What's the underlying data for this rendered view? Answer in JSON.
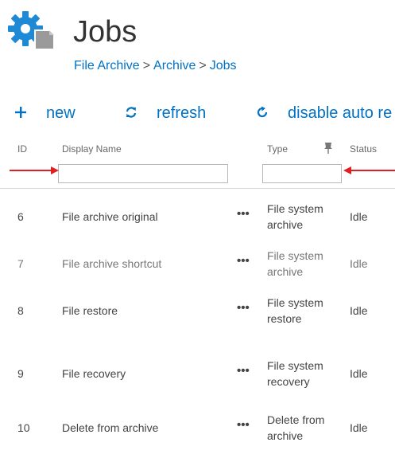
{
  "header": {
    "title": "Jobs",
    "breadcrumb": [
      "File Archive",
      "Archive",
      "Jobs"
    ],
    "breadcrumb_separator": ">"
  },
  "toolbar": {
    "new_label": "new",
    "refresh_label": "refresh",
    "disable_auto_refresh_label": "disable auto re"
  },
  "columns": {
    "id": "ID",
    "display_name": "Display Name",
    "type": "Type",
    "status": "Status"
  },
  "filters": {
    "display_name_value": "",
    "type_value": ""
  },
  "rows": [
    {
      "id": "6",
      "name": "File archive original",
      "type_line1": "File system",
      "type_line2": "archive",
      "status": "Idle"
    },
    {
      "id": "7",
      "name": "File archive shortcut",
      "type_line1": "File system",
      "type_line2": "archive",
      "status": "Idle"
    },
    {
      "id": "8",
      "name": "File restore",
      "type_line1": "File system",
      "type_line2": "restore",
      "status": "Idle"
    },
    {
      "id": "9",
      "name": "File recovery",
      "type_line1": "File system",
      "type_line2": "recovery",
      "status": "Idle"
    },
    {
      "id": "10",
      "name": "Delete from archive",
      "type_line1": "Delete from",
      "type_line2": "archive",
      "status": "Idle"
    }
  ],
  "row_menu_glyph": "•••",
  "colors": {
    "accent": "#0072c6",
    "annotation_arrow": "#e02020",
    "logo_blue": "#1e8ad6",
    "logo_gray": "#9a9a9a"
  },
  "icons": {
    "logo": "gear-document-icon",
    "new": "plus-icon",
    "refresh": "refresh-icon",
    "disable_auto_refresh": "auto-refresh-icon",
    "type_column": "pin-icon"
  }
}
